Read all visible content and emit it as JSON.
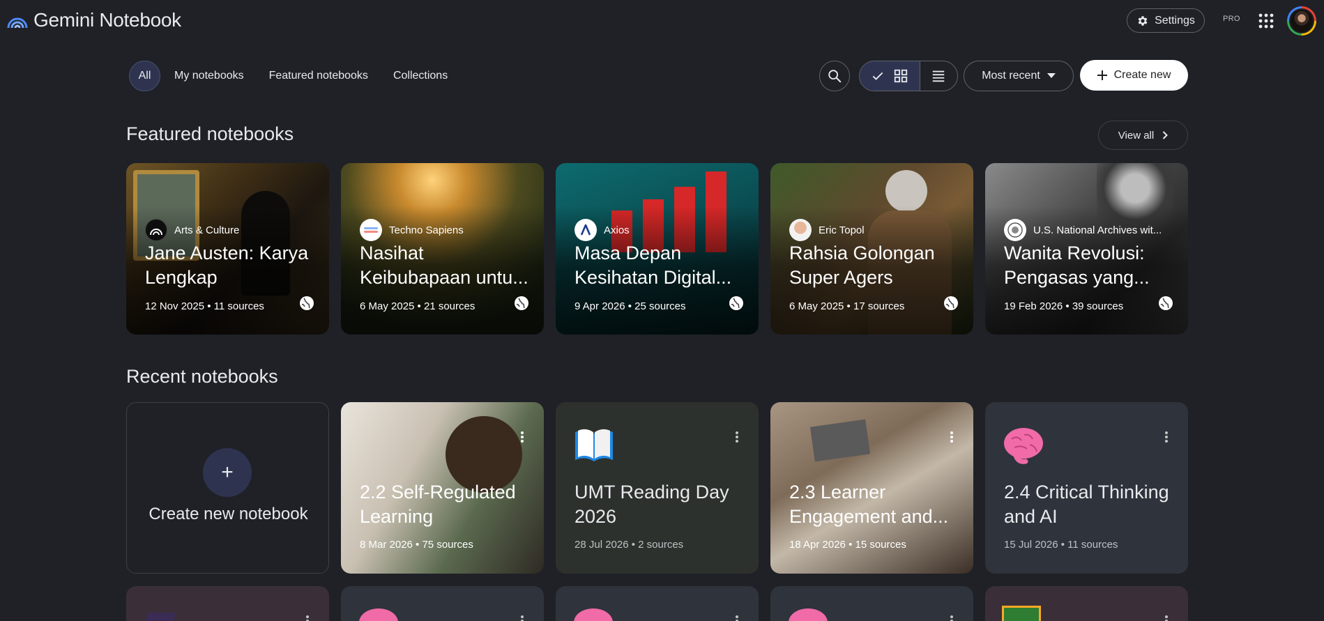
{
  "app": {
    "title": "Gemini Notebook"
  },
  "header": {
    "settings_label": "Settings",
    "pro_label": "PRO"
  },
  "filters": {
    "tabs": [
      "All",
      "My notebooks",
      "Featured notebooks",
      "Collections"
    ],
    "active": "All"
  },
  "toolbar": {
    "sort_label": "Most recent",
    "create_label": "Create new"
  },
  "featured": {
    "title": "Featured notebooks",
    "view_all_label": "View all",
    "cards": [
      {
        "source": "Arts & Culture",
        "title": "Jane Austen: Karya Lengkap",
        "meta": "12 Nov 2025 • 11 sources"
      },
      {
        "source": "Techno Sapiens",
        "title": "Nasihat Keibubapaan untu...",
        "meta": "6 May 2025 • 21 sources"
      },
      {
        "source": "Axios",
        "title": "Masa Depan Kesihatan Digital...",
        "meta": "9 Apr 2026 • 25 sources"
      },
      {
        "source": "Eric Topol",
        "title": "Rahsia Golongan Super Agers",
        "meta": "6 May 2025 • 17 sources"
      },
      {
        "source": "U.S. National Archives wit...",
        "title": "Wanita Revolusi: Pengasas yang...",
        "meta": "19 Feb 2026 • 39 sources"
      }
    ]
  },
  "recent": {
    "title": "Recent notebooks",
    "create_label": "Create new notebook",
    "cards": [
      {
        "title": "2.2 Self-Regulated Learning",
        "meta": "8 Mar 2026 • 75 sources"
      },
      {
        "title": "UMT Reading Day 2026",
        "meta": "28 Jul 2026 • 2 sources"
      },
      {
        "title": "2.3 Learner Engagement and...",
        "meta": "18 Apr 2026 • 15 sources"
      },
      {
        "title": "2.4 Critical Thinking and AI",
        "meta": "15 Jul 2026 • 11 sources"
      }
    ]
  },
  "icons": [
    "gemini-logo-icon",
    "gear-icon",
    "apps-grid-icon",
    "search-icon",
    "check-icon",
    "grid-view-icon",
    "list-view-icon",
    "caret-down-icon",
    "plus-icon",
    "chevron-right-icon",
    "globe-icon",
    "more-vert-icon",
    "book-emoji-icon",
    "brain-emoji-icon"
  ],
  "colors": {
    "background": "#1f2127",
    "active_chip": "#2e3450",
    "border": "#5f6368",
    "create_button": "#ffffff"
  }
}
